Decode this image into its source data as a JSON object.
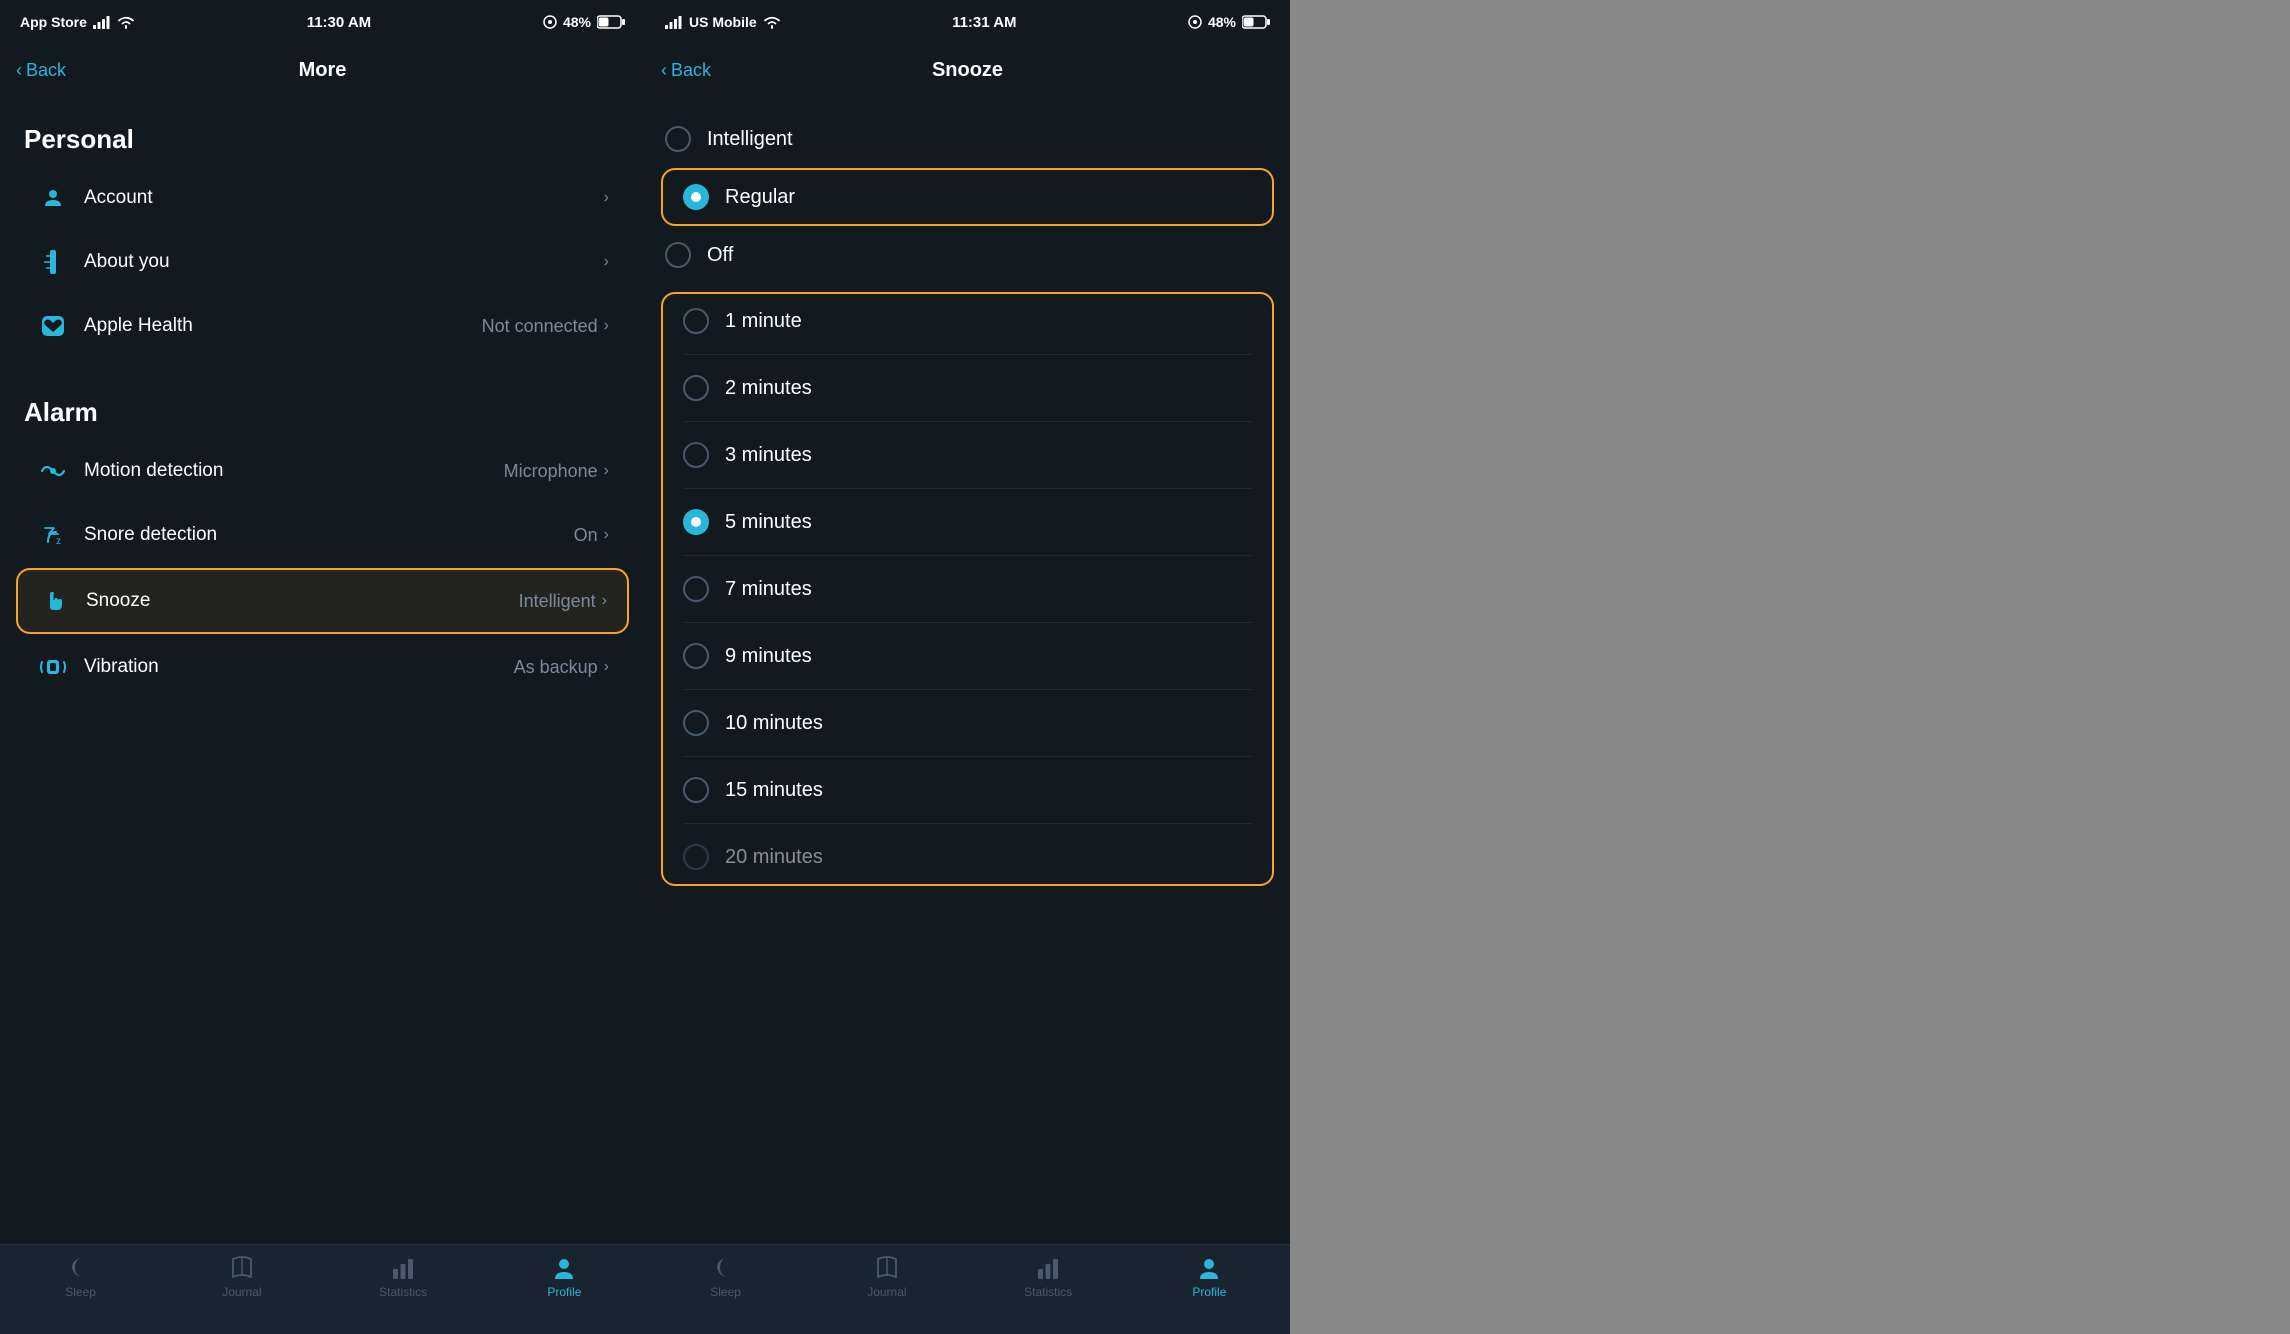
{
  "phone1": {
    "statusBar": {
      "left": "App Store",
      "time": "11:30 AM",
      "battery": "48%"
    },
    "nav": {
      "back": "Back",
      "title": "More"
    },
    "sections": [
      {
        "header": "Personal",
        "rows": [
          {
            "id": "account",
            "label": "Account",
            "value": "",
            "icon": "person",
            "highlighted": false
          },
          {
            "id": "about-you",
            "label": "About you",
            "value": "",
            "icon": "ruler",
            "highlighted": false
          },
          {
            "id": "apple-health",
            "label": "Apple Health",
            "value": "Not connected",
            "icon": "heart",
            "highlighted": false
          }
        ]
      },
      {
        "header": "Alarm",
        "rows": [
          {
            "id": "motion",
            "label": "Motion detection",
            "value": "Microphone",
            "icon": "motion",
            "highlighted": false
          },
          {
            "id": "snore",
            "label": "Snore detection",
            "value": "On",
            "icon": "snore",
            "highlighted": false
          },
          {
            "id": "snooze",
            "label": "Snooze",
            "value": "Intelligent",
            "icon": "hand",
            "highlighted": true
          },
          {
            "id": "vibration",
            "label": "Vibration",
            "value": "As backup",
            "icon": "vibration",
            "highlighted": false
          }
        ]
      }
    ],
    "tabBar": {
      "items": [
        {
          "id": "sleep",
          "label": "Sleep",
          "active": false
        },
        {
          "id": "journal",
          "label": "Journal",
          "active": false
        },
        {
          "id": "statistics",
          "label": "Statistics",
          "active": false
        },
        {
          "id": "profile",
          "label": "Profile",
          "active": true
        }
      ]
    }
  },
  "phone2": {
    "statusBar": {
      "left": "US Mobile",
      "time": "11:31 AM",
      "battery": "48%"
    },
    "nav": {
      "back": "Back",
      "title": "Snooze"
    },
    "snoozeTypes": [
      {
        "id": "intelligent",
        "label": "Intelligent",
        "selected": false,
        "boxed": false
      },
      {
        "id": "regular",
        "label": "Regular",
        "selected": true,
        "boxed": true
      },
      {
        "id": "off",
        "label": "Off",
        "selected": false,
        "boxed": false
      }
    ],
    "minutes": [
      {
        "id": "1min",
        "label": "1 minute",
        "selected": false
      },
      {
        "id": "2min",
        "label": "2 minutes",
        "selected": false
      },
      {
        "id": "3min",
        "label": "3 minutes",
        "selected": false
      },
      {
        "id": "5min",
        "label": "5 minutes",
        "selected": true
      },
      {
        "id": "7min",
        "label": "7 minutes",
        "selected": false
      },
      {
        "id": "9min",
        "label": "9 minutes",
        "selected": false
      },
      {
        "id": "10min",
        "label": "10 minutes",
        "selected": false
      },
      {
        "id": "15min",
        "label": "15 minutes",
        "selected": false
      },
      {
        "id": "20min",
        "label": "20 minutes",
        "selected": false
      }
    ],
    "tabBar": {
      "items": [
        {
          "id": "sleep",
          "label": "Sleep",
          "active": false
        },
        {
          "id": "journal",
          "label": "Journal",
          "active": false
        },
        {
          "id": "statistics",
          "label": "Statistics",
          "active": false
        },
        {
          "id": "profile",
          "label": "Profile",
          "active": true
        }
      ]
    }
  }
}
